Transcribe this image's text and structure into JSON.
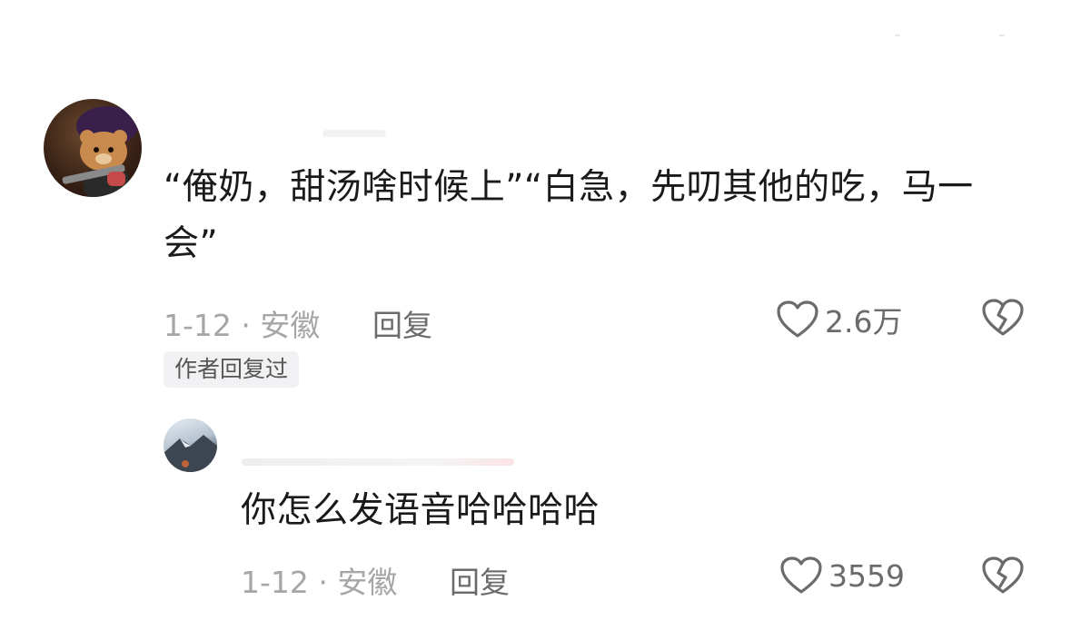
{
  "comments": [
    {
      "text": "“俺奶，甜汤啥时候上”“白急，先叨其他的吃，马一会”",
      "meta": "1-12 · 安徽",
      "reply_label": "回复",
      "likes": "2.6万",
      "badge": "作者回复过"
    }
  ],
  "replies": [
    {
      "text": "你怎么发语音哈哈哈哈",
      "meta": "1-12 · 安徽",
      "reply_label": "回复",
      "likes": "3559"
    }
  ],
  "icons": {
    "like": "heart-outline-icon",
    "dislike": "broken-heart-icon"
  },
  "colors": {
    "text": "#1a1a1a",
    "meta": "#a6a6a6",
    "secondary": "#6b6b6b",
    "badge_bg": "#f1f1f3"
  }
}
